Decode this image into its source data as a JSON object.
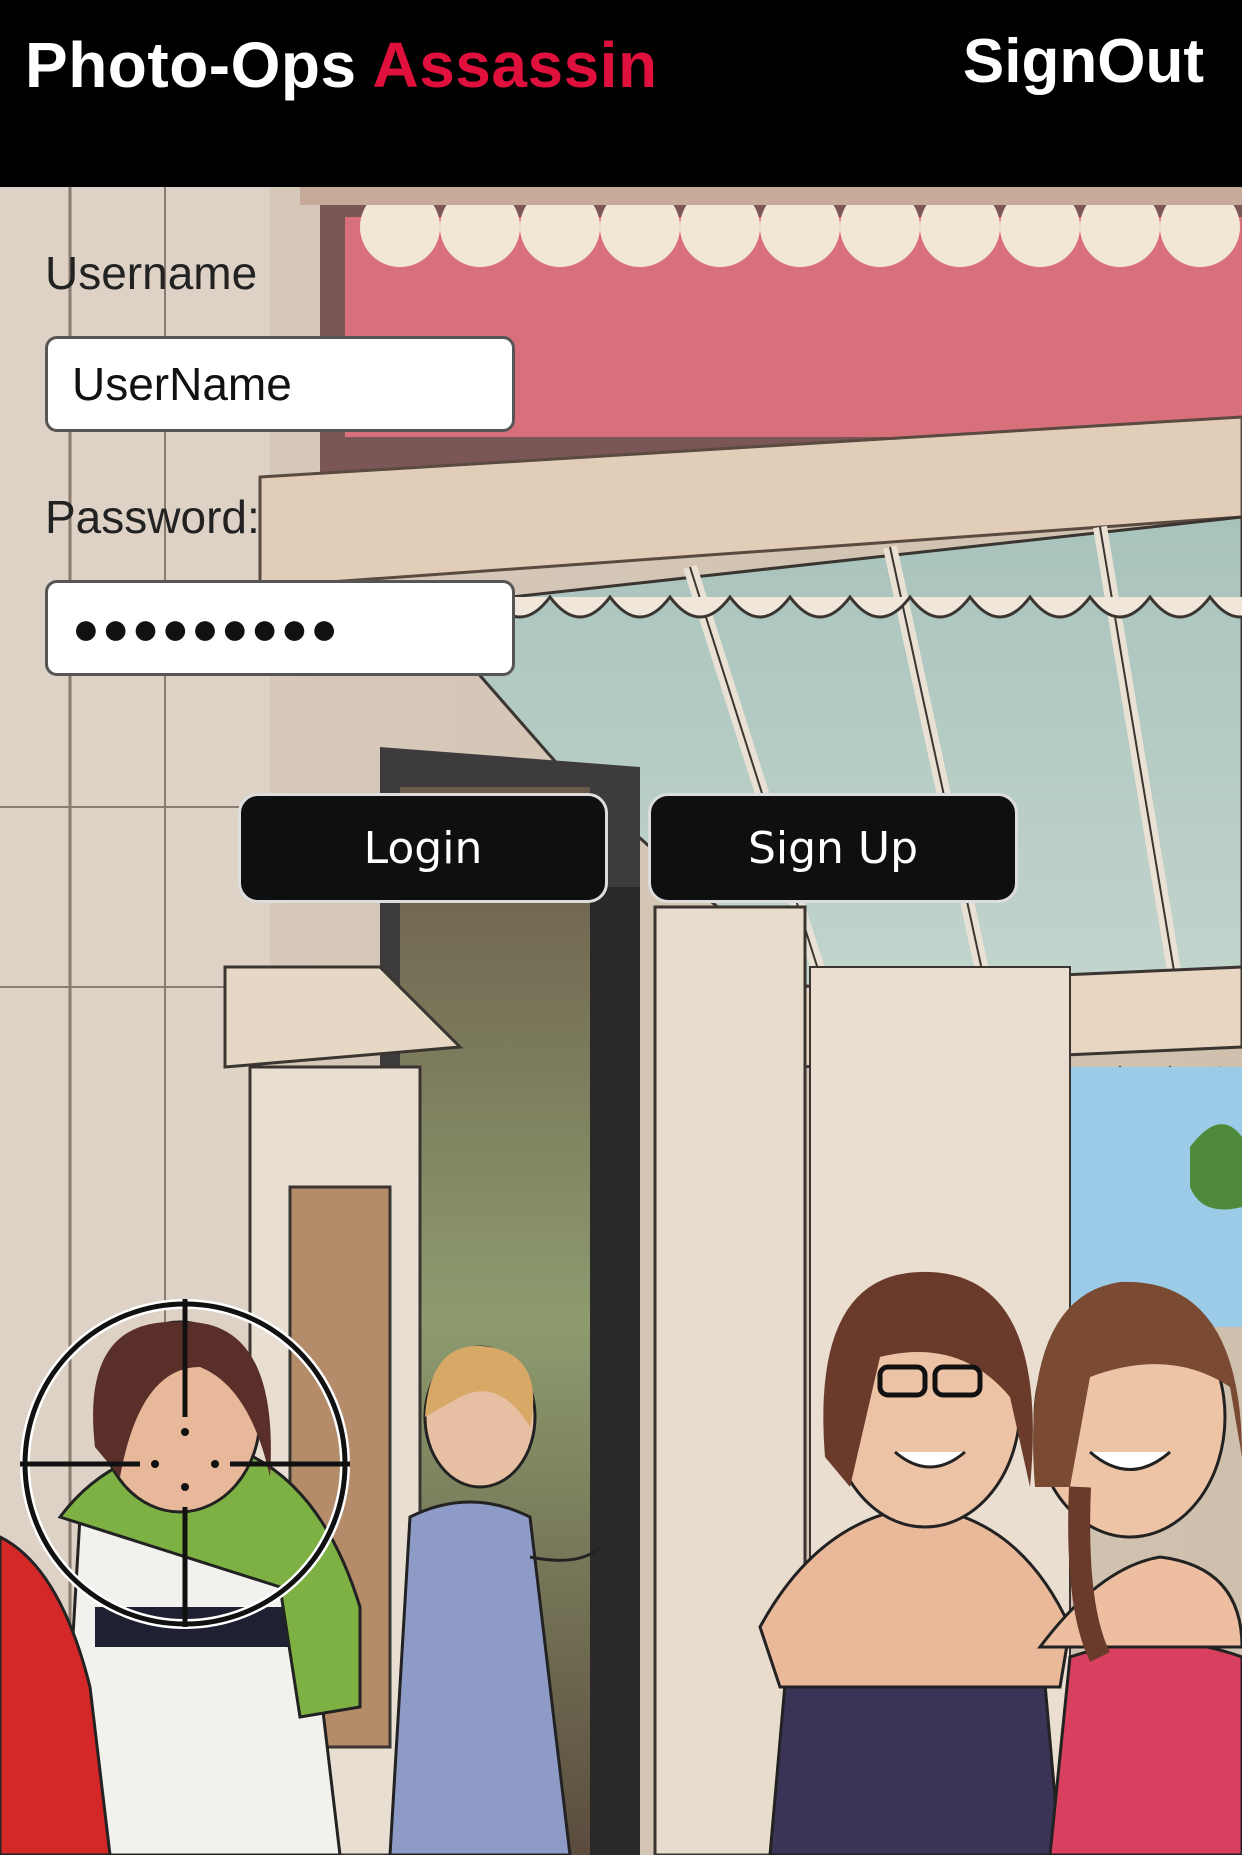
{
  "header": {
    "brand_part1": "Photo-Ops",
    "brand_part2": "Assassin",
    "brand_accent_color": "#e0103c",
    "signout_label": "SignOut"
  },
  "login_form": {
    "username_label": "Username",
    "username_value": "UserName",
    "password_label": "Password:",
    "password_value": "●●●●●●●●●",
    "login_button": "Login",
    "signup_button": "Sign Up"
  },
  "background": {
    "description_icon": "street-scene-illustration",
    "target_icon": "crosshair-reticle-icon"
  }
}
